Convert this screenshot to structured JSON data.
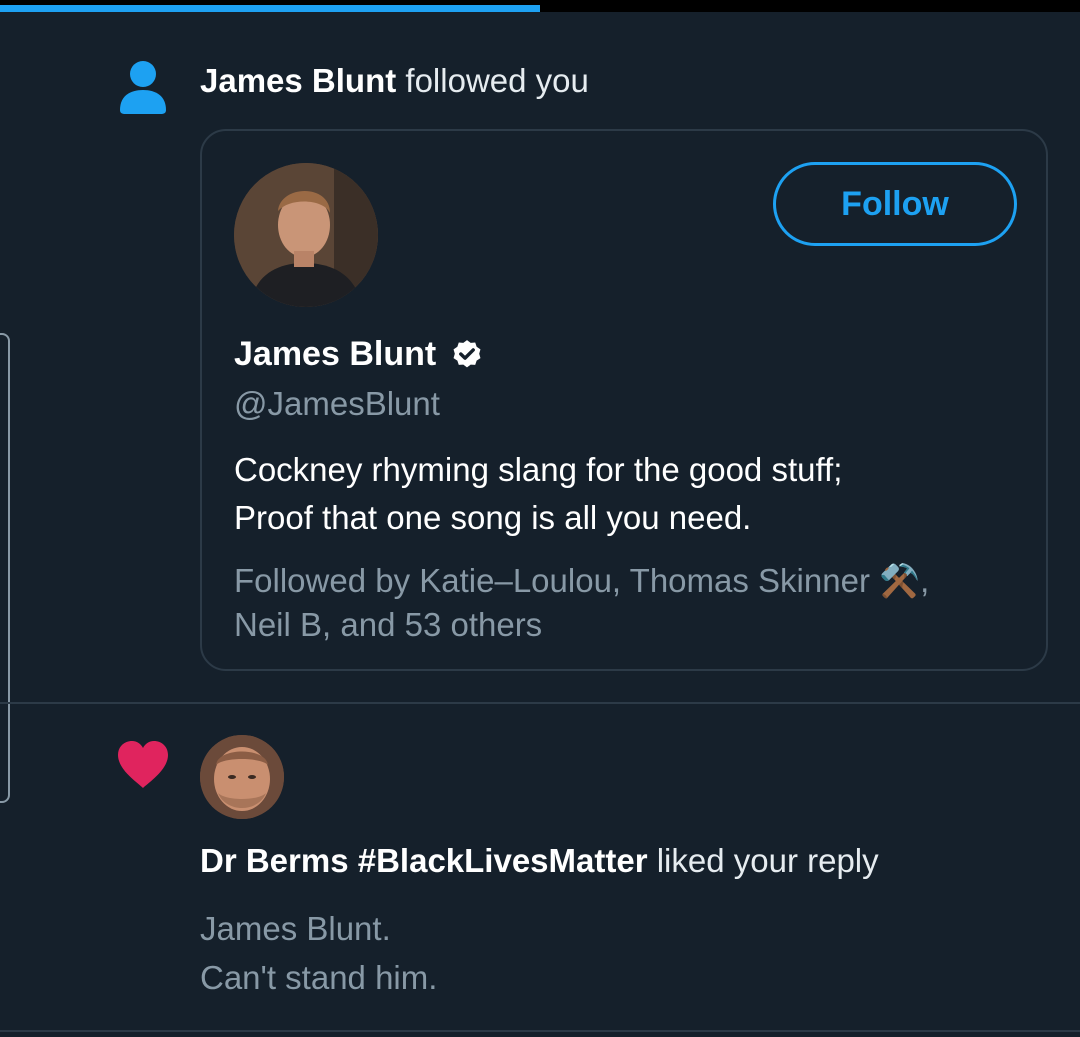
{
  "progress": {
    "fraction": 0.5
  },
  "follow_notification": {
    "icon": "person-icon",
    "actor_name": "James Blunt",
    "action_text": " followed you",
    "card": {
      "avatar_alt": "James Blunt avatar",
      "follow_label": "Follow",
      "name": "James Blunt",
      "verified_icon": "verified-badge-icon",
      "handle": "@JamesBlunt",
      "bio_line1": "Cockney rhyming slang for the good stuff;",
      "bio_line2": "Proof that one song is all you need.",
      "followed_by_line1": "Followed by Katie–Loulou, Thomas Skinner ⚒️,",
      "followed_by_line2": "Neil B, and 53 others"
    }
  },
  "like_notification": {
    "icon": "heart-icon",
    "actor_name": "Dr Berms #BlackLivesMatter",
    "action_text": " liked your reply",
    "reply_line1": "James Blunt.",
    "reply_line2": "Can't stand him."
  },
  "colors": {
    "background": "#15202b",
    "accent": "#1da1f2",
    "like": "#e0245e",
    "secondary_text": "#8899a6",
    "border": "#2c3a47"
  }
}
